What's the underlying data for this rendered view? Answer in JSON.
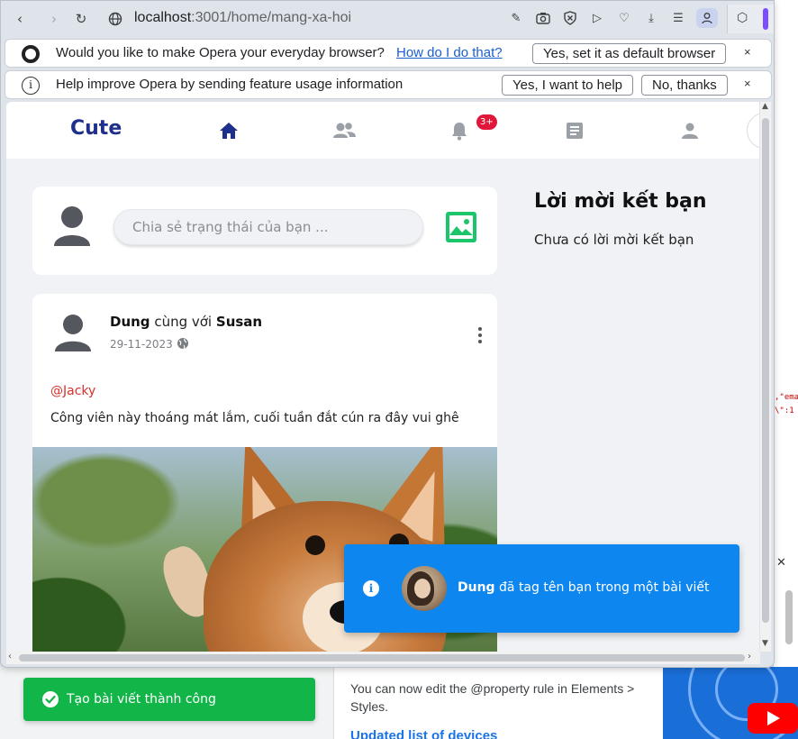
{
  "browser": {
    "url_host": "localhost",
    "url_path": ":3001/home/mang-xa-hoi",
    "infobar_default": {
      "text": "Would you like to make Opera your everyday browser?",
      "link": "How do I do that?",
      "button": "Yes, set it as default browser",
      "close": "×"
    },
    "infobar_feedback": {
      "text": "Help improve Opera by sending feature usage information",
      "accept": "Yes, I want to help",
      "decline": "No, thanks",
      "close": "×"
    }
  },
  "navbar": {
    "brand": "Cute",
    "notifications_badge": "3+",
    "icons": [
      "home-icon",
      "friends-icon",
      "bell-icon",
      "news-icon",
      "profile-icon"
    ],
    "active_color": "#1e2f8c",
    "inactive_color": "#9aa0a6"
  },
  "composer": {
    "placeholder": "Chia sẻ trạng thái của bạn ..."
  },
  "friend_requests": {
    "title": "Lời mời kết bạn",
    "empty": "Chưa có lời mời kết bạn"
  },
  "post": {
    "author": "Dung",
    "with_text": "cùng với",
    "tagged": "Susan",
    "date": "29-11-2023",
    "mention": "@Jacky",
    "text": "Công viên này thoáng mát lắm, cuối tuần đắt cún ra đây vui ghê"
  },
  "toasts": {
    "tag_notification": {
      "name": "Dung",
      "message": "đã tag tên bạn trong một bài viết"
    },
    "success": {
      "message": "Tạo bài viết thành công"
    }
  },
  "devtools": {
    "text": "You can now edit the @property rule in Elements > Styles.",
    "heading": "Updated list of devices"
  },
  "background_code": ",\"ema\n\\\":1"
}
